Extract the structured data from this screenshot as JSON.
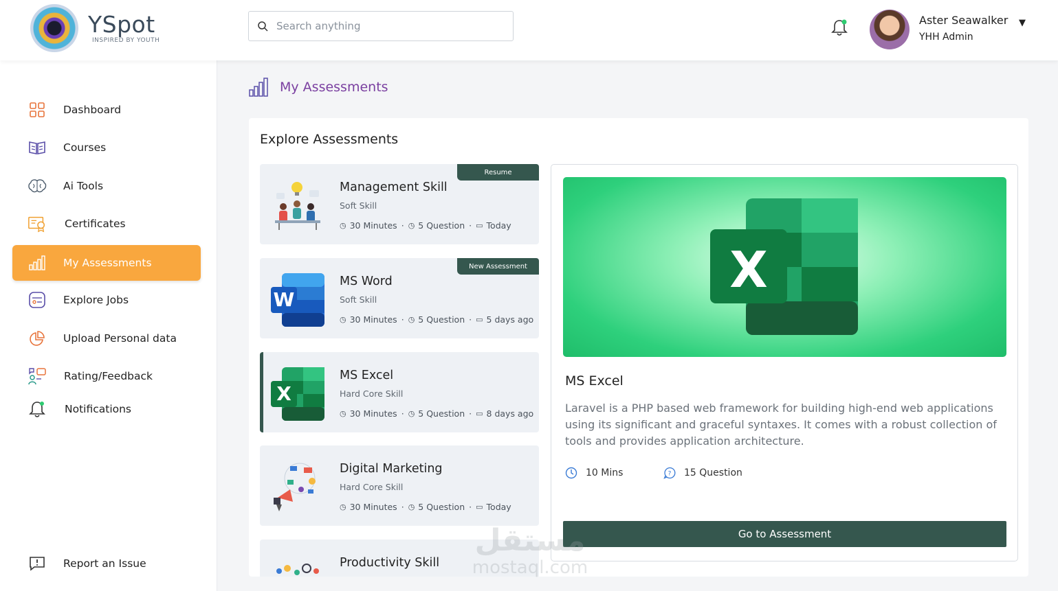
{
  "brand": {
    "name": "YSpot",
    "tagline": "INSPIRED BY YOUTH"
  },
  "search": {
    "placeholder": "Search anything",
    "value": ""
  },
  "user": {
    "name": "Aster Seawalker",
    "role": "YHH Admin"
  },
  "sidebar": {
    "items": [
      {
        "label": "Dashboard",
        "icon": "dashboard-icon"
      },
      {
        "label": "Courses",
        "icon": "book-icon"
      },
      {
        "label": "Ai Tools",
        "icon": "brain-icon"
      },
      {
        "label": "Certificates",
        "icon": "certificate-icon"
      },
      {
        "label": "My Assessments",
        "icon": "bar-chart-icon",
        "active": true
      },
      {
        "label": "Explore Jobs",
        "icon": "jobs-icon"
      },
      {
        "label": "Upload Personal data",
        "icon": "pie-chart-icon"
      },
      {
        "label": "Rating/Feedback",
        "icon": "feedback-icon"
      },
      {
        "label": "Notifications",
        "icon": "bell-icon"
      }
    ],
    "report": {
      "label": "Report an Issue",
      "icon": "report-icon"
    }
  },
  "page": {
    "title": "My Assessments"
  },
  "explore": {
    "heading": "Explore Assessments",
    "cards": [
      {
        "title": "Management Skill",
        "category": "Soft Skill",
        "duration": "30 Minutes",
        "questions": "5 Question",
        "date": "Today",
        "badge": "Resume"
      },
      {
        "title": "MS Word",
        "category": "Soft Skill",
        "duration": "30 Minutes",
        "questions": "5 Question",
        "date": "5 days ago",
        "badge": "New Assessment"
      },
      {
        "title": "MS Excel",
        "category": "Hard Core Skill",
        "duration": "30 Minutes",
        "questions": "5 Question",
        "date": "8 days ago",
        "selected": true
      },
      {
        "title": "Digital Marketing",
        "category": "Hard Core Skill",
        "duration": "30 Minutes",
        "questions": "5 Question",
        "date": "Today"
      },
      {
        "title": "Productivity Skill"
      }
    ]
  },
  "detail": {
    "title": "MS Excel",
    "description": "Laravel is a PHP based web framework for building high-end web applications using its significant and graceful syntaxes. It comes with a robust collection of tools and provides application architecture.",
    "duration": "10 Mins",
    "questions": "15 Question",
    "button": "Go to Assessment",
    "hero_letter": "X"
  },
  "thumb_letters": {
    "word": "W",
    "excel": "X"
  },
  "meta_separator": "·",
  "watermark": {
    "arabic": "مستقل",
    "latin": "mostaql.com"
  },
  "colors": {
    "accent": "#f9a73e",
    "primary": "#35574e",
    "title_purple": "#7a3fa0",
    "excel_green": "#1d7044"
  }
}
